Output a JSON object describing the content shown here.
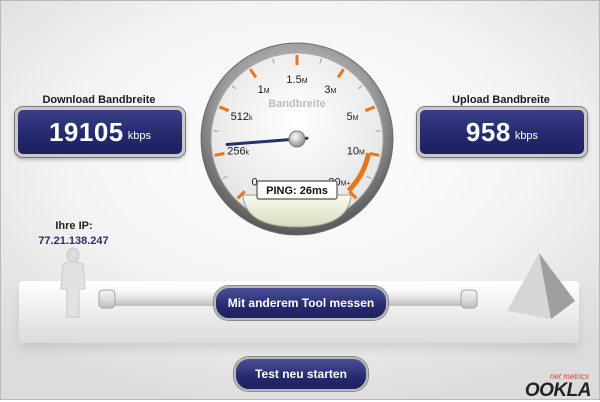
{
  "download": {
    "label": "Download Bandbreite",
    "value": "19105",
    "unit": "kbps"
  },
  "upload": {
    "label": "Upload Bandbreite",
    "value": "958",
    "unit": "kbps"
  },
  "gauge": {
    "title": "Bandbreite",
    "ticks": [
      {
        "num": "0",
        "suffix": ""
      },
      {
        "num": "256",
        "suffix": "k"
      },
      {
        "num": "512",
        "suffix": "k"
      },
      {
        "num": "1",
        "suffix": "M"
      },
      {
        "num": "1.5",
        "suffix": "M"
      },
      {
        "num": "3",
        "suffix": "M"
      },
      {
        "num": "5",
        "suffix": "M"
      },
      {
        "num": "10",
        "suffix": "M"
      },
      {
        "num": "20",
        "suffix": "M+"
      }
    ],
    "needle_fraction": 0.15,
    "ping_text": "PING: 26ms",
    "accent_color": "#e8761c"
  },
  "ip": {
    "label": "Ihre IP:",
    "value": "77.21.138.247"
  },
  "buttons": {
    "other_tool": "Mit anderem Tool messen",
    "restart": "Test neu starten"
  },
  "logo": {
    "tagline": "net metrics",
    "name": "OOKLA"
  }
}
